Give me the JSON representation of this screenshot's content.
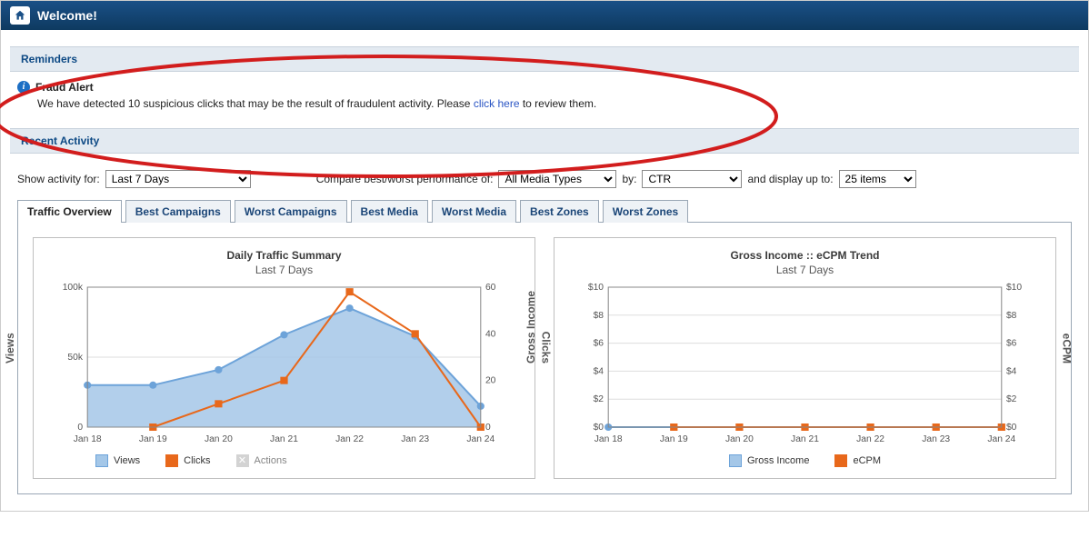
{
  "header": {
    "title": "Welcome!"
  },
  "reminders": {
    "section_label": "Reminders",
    "alert_title": "Fraud Alert",
    "alert_text_before": "We have detected 10 suspicious clicks that may be the result of fraudulent activity. Please ",
    "alert_link": "click here",
    "alert_text_after": " to review them."
  },
  "recent_activity": {
    "section_label": "Recent Activity"
  },
  "controls": {
    "show_label": "Show activity for:",
    "show_value": "Last 7 Days",
    "compare_label": "Compare best/worst performance of:",
    "compare_value": "All Media Types",
    "by_label": "by:",
    "by_value": "CTR",
    "display_label": "and display up to:",
    "display_value": "25 items"
  },
  "tabs": [
    {
      "label": "Traffic Overview",
      "active": true
    },
    {
      "label": "Best Campaigns"
    },
    {
      "label": "Worst Campaigns"
    },
    {
      "label": "Best Media"
    },
    {
      "label": "Worst Media"
    },
    {
      "label": "Best Zones"
    },
    {
      "label": "Worst Zones"
    }
  ],
  "chart_data": [
    {
      "type": "line",
      "title": "Daily Traffic Summary",
      "subtitle": "Last 7 Days",
      "xlabel": "",
      "ylabel_left": "Views",
      "ylabel_right": "Clicks",
      "categories": [
        "Jan 18",
        "Jan 19",
        "Jan 20",
        "Jan 21",
        "Jan 22",
        "Jan 23",
        "Jan 24"
      ],
      "y_left_ticks": [
        0,
        "50k",
        "100k"
      ],
      "y_left_values": [
        0,
        50000,
        100000
      ],
      "y_right_ticks": [
        0,
        20,
        40,
        60
      ],
      "series": [
        {
          "name": "Views",
          "axis": "left",
          "color": "#6da3d9",
          "fill": "#a4c7e8",
          "marker": "circle",
          "values": [
            30000,
            30000,
            41000,
            66000,
            85000,
            65000,
            15000
          ]
        },
        {
          "name": "Clicks",
          "axis": "right",
          "color": "#e8681b",
          "fill": null,
          "marker": "square",
          "values": [
            null,
            0,
            10,
            20,
            58,
            40,
            0
          ]
        }
      ],
      "disabled_series": [
        {
          "name": "Actions",
          "color": "#b7b7b7"
        }
      ]
    },
    {
      "type": "line",
      "title": "Gross Income :: eCPM Trend",
      "subtitle": "Last 7 Days",
      "xlabel": "",
      "ylabel_left": "Gross Income",
      "ylabel_right": "eCPM",
      "categories": [
        "Jan 18",
        "Jan 19",
        "Jan 20",
        "Jan 21",
        "Jan 22",
        "Jan 23",
        "Jan 24"
      ],
      "y_left_ticks": [
        "$0",
        "$2",
        "$4",
        "$6",
        "$8",
        "$10"
      ],
      "y_left_values": [
        0,
        2,
        4,
        6,
        8,
        10
      ],
      "y_right_ticks": [
        "$0",
        "$2",
        "$4",
        "$6",
        "$8",
        "$10"
      ],
      "series": [
        {
          "name": "Gross Income",
          "axis": "left",
          "color": "#6da3d9",
          "fill": "#a4c7e8",
          "marker": "circle",
          "values": [
            0,
            0,
            0,
            0,
            0,
            0,
            0
          ]
        },
        {
          "name": "eCPM",
          "axis": "right",
          "color": "#e8681b",
          "fill": null,
          "marker": "square",
          "values": [
            null,
            0,
            0,
            0,
            0,
            0,
            0
          ]
        }
      ]
    }
  ]
}
